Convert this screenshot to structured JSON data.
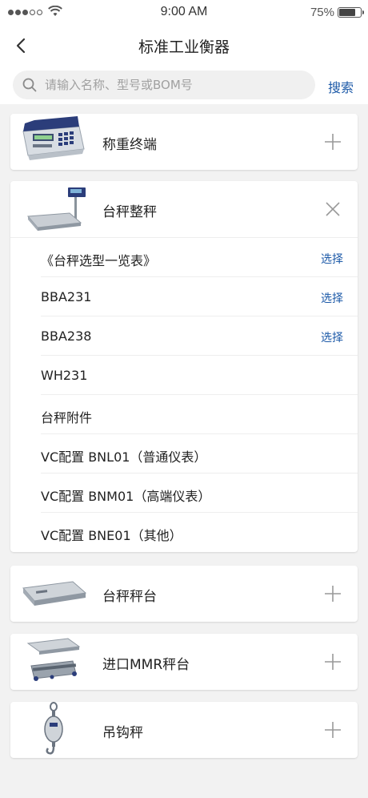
{
  "status_bar": {
    "time": "9:00 AM",
    "battery": "75%",
    "battery_level": 0.75
  },
  "header": {
    "title": "标准工业衡器"
  },
  "search": {
    "placeholder": "请输入名称、型号或BOM号",
    "button_label": "搜索"
  },
  "categories": [
    {
      "label": "称重终端",
      "icon": "weighing-terminal-image",
      "expanded": false
    },
    {
      "label": "台秤整秤",
      "icon": "platform-scale-image",
      "expanded": true,
      "items": [
        {
          "label": "《台秤选型一览表》",
          "action": "选择"
        },
        {
          "label": "BBA231",
          "action": "选择"
        },
        {
          "label": "BBA238",
          "action": "选择"
        },
        {
          "label": "WH231",
          "action": ""
        },
        {
          "label": "台秤附件",
          "action": ""
        },
        {
          "label": "VC配置 BNL01（普通仪表）",
          "action": ""
        },
        {
          "label": "VC配置 BNM01（高端仪表）",
          "action": ""
        },
        {
          "label": "VC配置 BNE01（其他）",
          "action": ""
        }
      ]
    },
    {
      "label": "台秤秤台",
      "icon": "scale-platform-image",
      "expanded": false
    },
    {
      "label": "进口MMR秤台",
      "icon": "mmr-platform-image",
      "expanded": false
    },
    {
      "label": "吊钩秤",
      "icon": "hook-scale-image",
      "expanded": false
    }
  ],
  "colors": {
    "accent": "#1d5aa8",
    "background": "#f2f2f2"
  }
}
